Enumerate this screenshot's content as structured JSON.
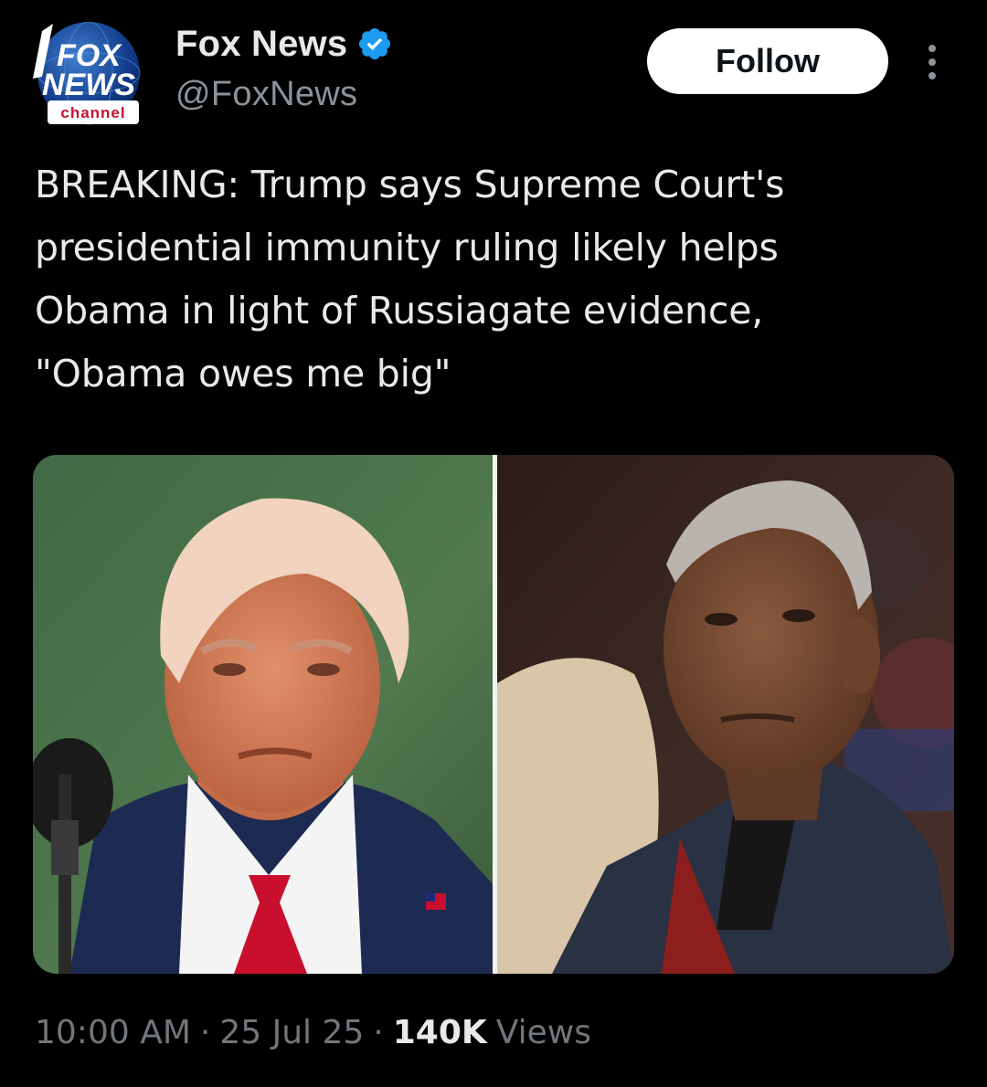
{
  "author": {
    "display_name": "Fox News",
    "handle": "@FoxNews",
    "verified": true,
    "avatar": {
      "logo_text_line1": "FOX",
      "logo_text_line2": "NEWS",
      "logo_subtext": "channel"
    }
  },
  "actions": {
    "follow_label": "Follow",
    "more_icon": "more-vertical-icon"
  },
  "tweet": {
    "text": "BREAKING: Trump says Supreme Court's\npresidential immunity ruling likely helps\nObama in light of Russiagate evidence,\n\"Obama owes me big\""
  },
  "media": {
    "count": 2,
    "images": [
      {
        "subject": "Donald Trump"
      },
      {
        "subject": "Barack Obama"
      }
    ]
  },
  "meta": {
    "time": "10:00 AM",
    "date": "25 Jul 25",
    "views_count": "140K",
    "views_label": "Views",
    "separator": "·"
  },
  "colors": {
    "background": "#000000",
    "text_primary": "#e7e9ea",
    "text_secondary": "#71767b",
    "verified_blue": "#1d9bf0",
    "follow_bg": "#ffffff"
  }
}
